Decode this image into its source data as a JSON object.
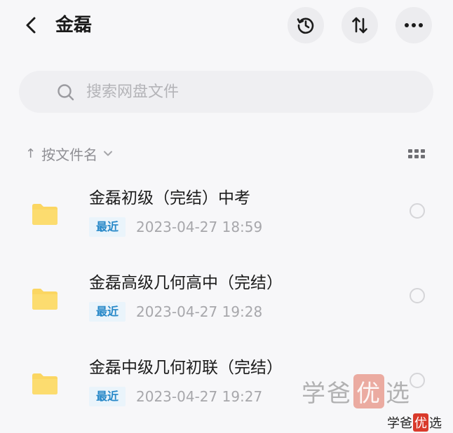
{
  "header": {
    "title": "金磊",
    "back_icon": "chevron-left-icon",
    "history_icon": "history-icon",
    "sort_icon": "sort-icon",
    "more_icon": "more-icon"
  },
  "search": {
    "placeholder": "搜索网盘文件",
    "value": ""
  },
  "sort": {
    "arrow": "↑",
    "label": "按文件名",
    "chevron_icon": "chevron-down-icon",
    "view_icon": "grid-view-icon"
  },
  "files": [
    {
      "name": "金磊初级（完结）中考",
      "badge": "最近",
      "time": "2023-04-27  18:59"
    },
    {
      "name": "金磊高级几何高中（完结）",
      "badge": "最近",
      "time": "2023-04-27  19:28"
    },
    {
      "name": "金磊中级几何初联（完结）",
      "badge": "最近",
      "time": "2023-04-27  19:27"
    }
  ],
  "watermark": {
    "large": {
      "part1": "学爸",
      "highlight": "优",
      "part2": "选"
    },
    "small": {
      "part1": "学爸",
      "highlight": "优",
      "part2": "选"
    }
  },
  "colors": {
    "background": "#f7f7f9",
    "folder": "#fbd662",
    "badge_text": "#2788c8",
    "badge_bg": "#eaf4fb",
    "watermark_red": "#d93a2b"
  }
}
